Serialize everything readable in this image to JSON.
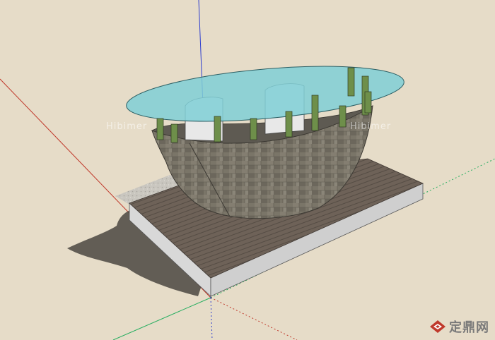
{
  "viewport": {
    "background": "#e6dcc8",
    "axis_colors": {
      "red": "#c0392b",
      "green": "#27ae60",
      "blue": "#2e3ecf"
    }
  },
  "model": {
    "glass_color": "#7fcfd6",
    "stone_color": "#7a7568",
    "deck_color": "#6e6258",
    "slab_edge_color": "#d8d8d8",
    "post_color": "#6e8f4a"
  },
  "watermark": {
    "left": "Hibimer",
    "right": "Hibimer"
  },
  "brand": {
    "logo_icon": "diamond-house-logo-icon",
    "text": "定鼎网"
  }
}
